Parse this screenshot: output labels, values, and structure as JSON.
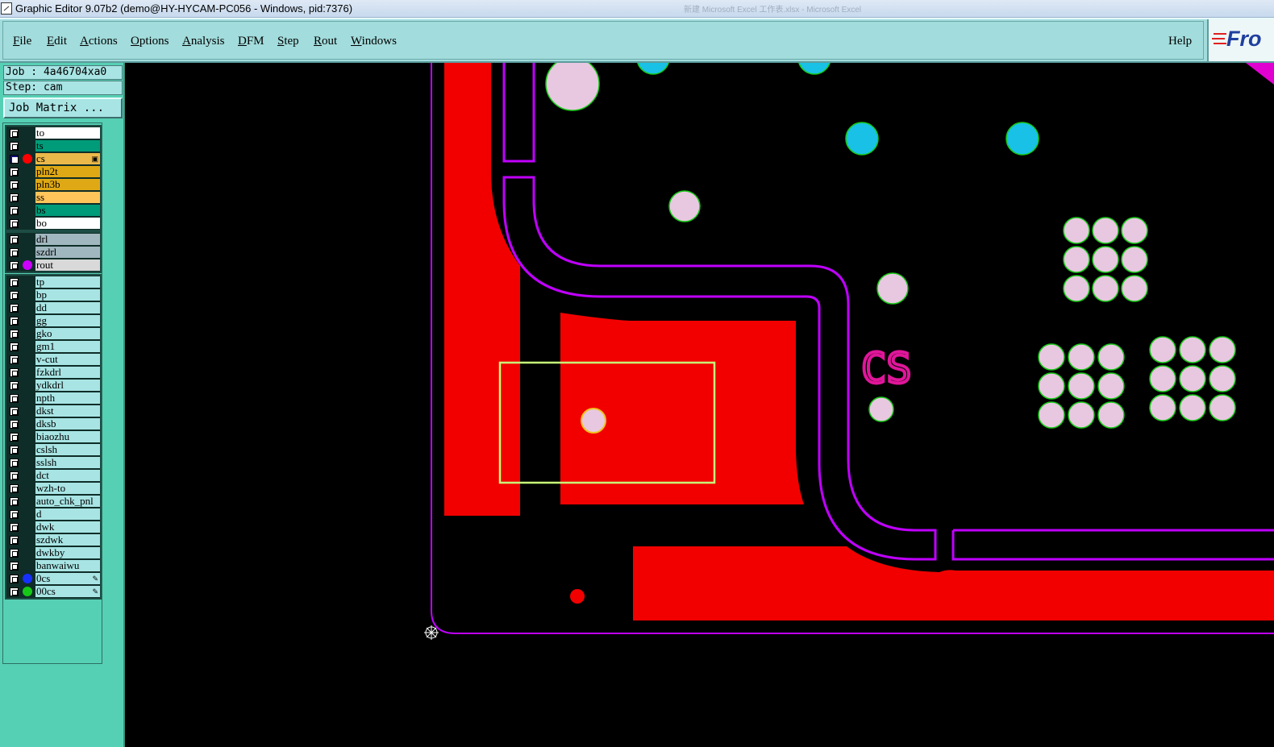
{
  "window": {
    "title": "Graphic Editor 9.07b2 (demo@HY-HYCAM-PC056 - Windows, pid:7376)",
    "background_window_title": "新建 Microsoft Excel 工作表.xlsx - Microsoft Excel"
  },
  "menu": {
    "items": [
      {
        "mnemonic": "F",
        "rest": "ile"
      },
      {
        "mnemonic": "E",
        "rest": "dit"
      },
      {
        "mnemonic": "A",
        "rest": "ctions"
      },
      {
        "mnemonic": "O",
        "rest": "ptions"
      },
      {
        "mnemonic": "A",
        "rest": "nalysis"
      },
      {
        "mnemonic": "D",
        "rest": "FM"
      },
      {
        "mnemonic": "S",
        "rest": "tep"
      },
      {
        "mnemonic": "R",
        "rest": "out"
      },
      {
        "mnemonic": "W",
        "rest": "indows"
      }
    ],
    "help": "Help",
    "logo_text": "Fro"
  },
  "panel": {
    "job": "Job : 4a46704xa0",
    "step": "Step: cam",
    "job_matrix": "Job Matrix ..."
  },
  "layers": {
    "board": [
      {
        "name": "to",
        "color": "#ffffff"
      },
      {
        "name": "ts",
        "color": "#009b78"
      },
      {
        "name": "cs",
        "color": "#ebb84a",
        "selected": true,
        "dot": "#ff0000",
        "mark": "▣"
      },
      {
        "name": "pln2t",
        "color": "#dfa915"
      },
      {
        "name": "pln3b",
        "color": "#dfa915"
      },
      {
        "name": "ss",
        "color": "#ffc55a"
      },
      {
        "name": "bs",
        "color": "#009b78"
      },
      {
        "name": "bo",
        "color": "#ffffff"
      }
    ],
    "drill": [
      {
        "name": "drl",
        "color": "#a1b7bf"
      },
      {
        "name": "szdrl",
        "color": "#a1b7bf"
      },
      {
        "name": "rout",
        "color": "#d9d9d9",
        "dot": "#cc00ff"
      }
    ],
    "misc": [
      {
        "name": "tp",
        "color": "#a8e4e4"
      },
      {
        "name": "bp",
        "color": "#a8e4e4"
      },
      {
        "name": "dd",
        "color": "#a8e4e4"
      },
      {
        "name": "gg",
        "color": "#a8e4e4"
      },
      {
        "name": "gko",
        "color": "#a8e4e4"
      },
      {
        "name": "gm1",
        "color": "#a8e4e4"
      },
      {
        "name": "v-cut",
        "color": "#a8e4e4"
      },
      {
        "name": "fzkdrl",
        "color": "#a8e4e4"
      },
      {
        "name": "ydkdrl",
        "color": "#a8e4e4"
      },
      {
        "name": "npth",
        "color": "#a8e4e4"
      },
      {
        "name": "dkst",
        "color": "#a8e4e4"
      },
      {
        "name": "dksb",
        "color": "#a8e4e4"
      },
      {
        "name": "biaozhu",
        "color": "#a8e4e4"
      },
      {
        "name": "cslsh",
        "color": "#a8e4e4"
      },
      {
        "name": "sslsh",
        "color": "#a8e4e4"
      },
      {
        "name": "dct",
        "color": "#a8e4e4"
      },
      {
        "name": "wzh-to",
        "color": "#a8e4e4"
      },
      {
        "name": "auto_chk_pnl",
        "color": "#a8e4e4"
      },
      {
        "name": "d",
        "color": "#a8e4e4"
      },
      {
        "name": "dwk",
        "color": "#a8e4e4"
      },
      {
        "name": "szdwk",
        "color": "#a8e4e4"
      },
      {
        "name": "dwkby",
        "color": "#a8e4e4"
      },
      {
        "name": "banwaiwu",
        "color": "#a8e4e4"
      },
      {
        "name": "0cs",
        "color": "#a8e4e4",
        "dot": "#1530ff",
        "mark": "✎"
      },
      {
        "name": "00cs",
        "color": "#a8e4e4",
        "dot": "#17c917",
        "mark": "✎"
      }
    ]
  },
  "canvas": {
    "silkscreen_text": "CS",
    "colors": {
      "copper": "#f20000",
      "rout": "#c000ff",
      "silk": "#e0169a",
      "pad_fill": "#e8c8e0",
      "pad_edge": "#17c917",
      "via": "#19c1e6",
      "highlight": "#c8ff78"
    }
  }
}
